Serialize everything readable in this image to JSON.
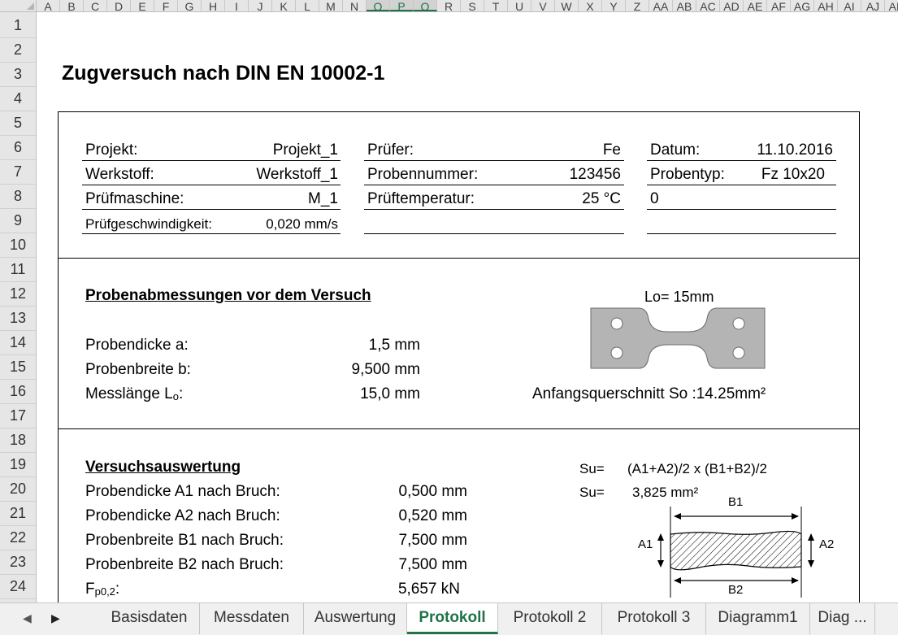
{
  "column_headers": [
    "A",
    "B",
    "C",
    "D",
    "E",
    "F",
    "G",
    "H",
    "I",
    "J",
    "K",
    "L",
    "M",
    "N",
    "O",
    "P",
    "Q",
    "R",
    "S",
    "T",
    "U",
    "V",
    "W",
    "X",
    "Y",
    "Z",
    "AA",
    "AB",
    "AC",
    "AD",
    "AE",
    "AF",
    "AG",
    "AH",
    "AI",
    "AJ",
    "AK"
  ],
  "selected_columns": [
    "O",
    "P",
    "Q"
  ],
  "row_numbers": [
    "1",
    "2",
    "3",
    "4",
    "5",
    "6",
    "7",
    "8",
    "9",
    "10",
    "11",
    "12",
    "13",
    "14",
    "15",
    "16",
    "17",
    "18",
    "19",
    "20",
    "21",
    "22",
    "23",
    "24"
  ],
  "title": "Zugversuch nach DIN EN 10002-1",
  "header_info": {
    "projekt_label": "Projekt:",
    "projekt_value": "Projekt_1",
    "werkstoff_label": "Werkstoff:",
    "werkstoff_value": "Werkstoff_1",
    "pruefmaschine_label": "Prüfmaschine:",
    "pruefmaschine_value": "M_1",
    "pruefgeschw_label": "Prüfgeschwindigkeit:",
    "pruefgeschw_value": "0,020 mm/s",
    "pruefer_label": "Prüfer:",
    "pruefer_value": "Fe",
    "probennummer_label": "Probennummer:",
    "probennummer_value": "123456",
    "prueftemp_label": "Prüftemperatur:",
    "prueftemp_value": "25 °C",
    "datum_label": "Datum:",
    "datum_value": "11.10.2016",
    "probentyp_label": "Probentyp:",
    "probentyp_value": "Fz 10x20",
    "extra_value": "0"
  },
  "abmessungen": {
    "heading": "Probenabmessungen vor dem Versuch",
    "dicke_label": "Probendicke a:",
    "dicke_value": "1,5 mm",
    "breite_label": "Probenbreite b:",
    "breite_value": "9,500 mm",
    "messlaenge_label": "Messlänge L",
    "messlaenge_sub": "o",
    "messlaenge_colon": ":",
    "messlaenge_value": "15,0 mm",
    "lo_caption": "Lo= 15mm",
    "querschnitt_caption": "Anfangsquerschnitt So :14.25mm²"
  },
  "auswertung": {
    "heading": "Versuchsauswertung",
    "a1_label": "Probendicke A1 nach Bruch:",
    "a1_value": "0,500 mm",
    "a2_label": "Probendicke A2 nach Bruch:",
    "a2_value": "0,520 mm",
    "b1_label": "Probenbreite B1 nach Bruch:",
    "b1_value": "7,500 mm",
    "b2_label": "Probenbreite B2 nach Bruch:",
    "b2_value": "7,500 mm",
    "fp_label_main": "F",
    "fp_label_sub": "p0,2",
    "fp_label_colon": ":",
    "fp_value": "5,657 kN",
    "su_label1": "Su=",
    "su_formula": "(A1+A2)/2 x (B1+B2)/2",
    "su_label2": "Su=",
    "su_value": "3,825 mm²",
    "diagram": {
      "b1": "B1",
      "b2": "B2",
      "a1": "A1",
      "a2": "A2"
    }
  },
  "tabs": [
    "Basisdaten",
    "Messdaten",
    "Auswertung",
    "Protokoll",
    "Protokoll 2",
    "Protokoll 3",
    "Diagramm1",
    "Diag ..."
  ],
  "active_tab": "Protokoll",
  "colors": {
    "excel_green": "#217346",
    "specimen_fill": "#b4b4b4"
  },
  "icons": [
    "scroll-left-icon",
    "scroll-right-icon"
  ]
}
